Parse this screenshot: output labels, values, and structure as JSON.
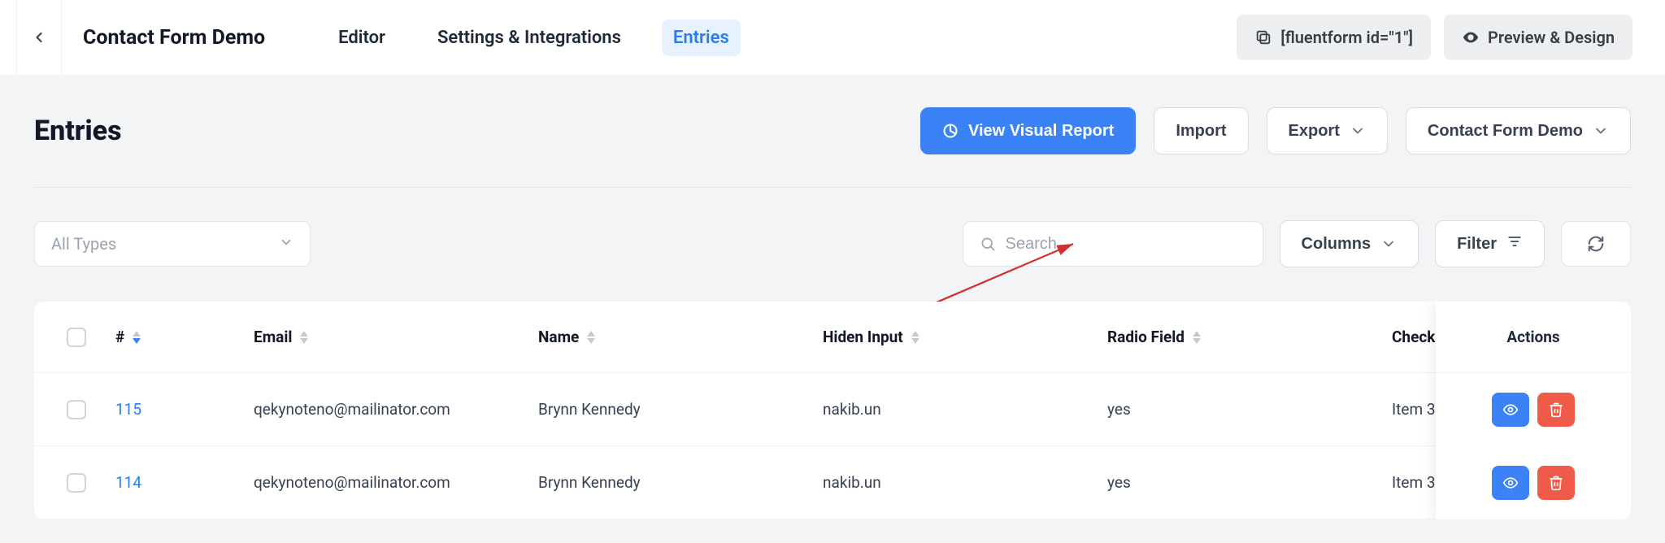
{
  "header": {
    "form_title": "Contact Form Demo",
    "tabs": {
      "editor": "Editor",
      "settings": "Settings & Integrations",
      "entries": "Entries"
    },
    "shortcode": "[fluentform id=\"1\"]",
    "preview": "Preview & Design"
  },
  "page": {
    "title": "Entries",
    "visual_report_btn": "View Visual Report",
    "import_btn": "Import",
    "export_btn": "Export",
    "form_selector": "Contact Form Demo"
  },
  "toolbar": {
    "type_filter": "All Types",
    "search_placeholder": "Search",
    "columns_btn": "Columns",
    "filter_btn": "Filter"
  },
  "table": {
    "columns": {
      "id": "#",
      "email": "Email",
      "name": "Name",
      "hidden": "Hiden Input",
      "radio": "Radio Field",
      "checkbox": "Checkb",
      "actions": "Actions"
    },
    "rows": [
      {
        "id": "115",
        "email": "qekynoteno@mailinator.com",
        "name": "Brynn Kennedy",
        "hidden": "nakib.un",
        "radio": "yes",
        "checkbox": "Item 3"
      },
      {
        "id": "114",
        "email": "qekynoteno@mailinator.com",
        "name": "Brynn Kennedy",
        "hidden": "nakib.un",
        "radio": "yes",
        "checkbox": "Item 3"
      }
    ]
  }
}
